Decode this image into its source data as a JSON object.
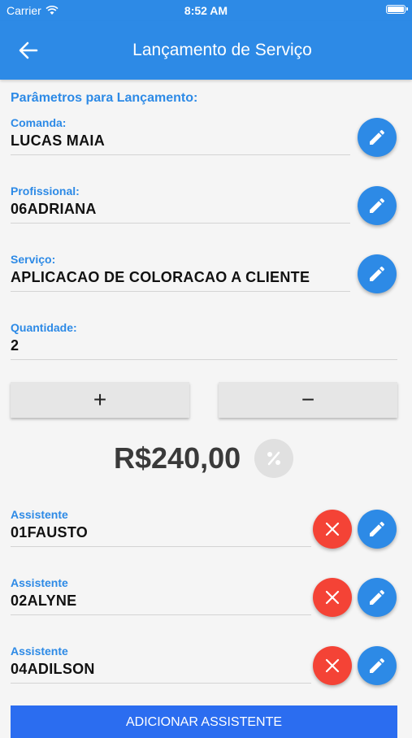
{
  "status_bar": {
    "carrier": "Carrier",
    "time": "8:52 AM"
  },
  "header": {
    "title": "Lançamento de Serviço"
  },
  "section_title": "Parâmetros para Lançamento:",
  "comanda": {
    "label": "Comanda:",
    "value": "LUCAS MAIA"
  },
  "profissional": {
    "label": "Profissional:",
    "value": "06ADRIANA"
  },
  "servico": {
    "label": "Serviço:",
    "value": "APLICACAO DE COLORACAO  A CLIENTE"
  },
  "quantidade": {
    "label": "Quantidade:",
    "value": "2"
  },
  "stepper": {
    "plus": "+",
    "minus": "−"
  },
  "price": "R$240,00",
  "assistants": [
    {
      "label": "Assistente",
      "value": "01FAUSTO"
    },
    {
      "label": "Assistente",
      "value": "02ALYNE"
    },
    {
      "label": "Assistente",
      "value": "04ADILSON"
    }
  ],
  "add_assistant_label": "ADICIONAR ASSISTENTE",
  "colors": {
    "primary": "#2d8ae6",
    "danger": "#f44336",
    "button_blue": "#2b6df0"
  },
  "icons": [
    "wifi-icon",
    "battery-icon",
    "back-arrow-icon",
    "pencil-icon",
    "close-icon",
    "percent-icon"
  ]
}
